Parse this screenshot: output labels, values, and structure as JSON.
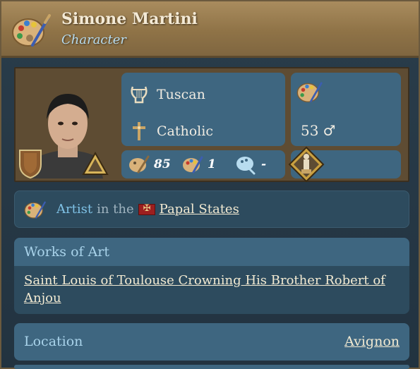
{
  "header": {
    "title": "Simone Martini",
    "subtitle": "Character",
    "icon": "palette-icon"
  },
  "portrait": {
    "culture": {
      "label": "Tuscan",
      "icon": "lyre-icon"
    },
    "religion": {
      "label": "Catholic",
      "icon": "crucifix-icon"
    },
    "age": {
      "value": "53",
      "gender_symbol": "♂"
    },
    "profession_icon": "palette-icon",
    "skills": [
      {
        "icon": "palette-brush-icon",
        "value": "85"
      },
      {
        "icon": "palette-icon",
        "value": "1"
      },
      {
        "icon": "paint-palette-blue-icon",
        "value": "-"
      }
    ],
    "trait_icon": "statue-icon"
  },
  "occupation": {
    "role": "Artist",
    "connector": "in the",
    "realm": "Papal States"
  },
  "works": {
    "heading": "Works of Art",
    "items": [
      "Saint Louis of Toulouse Crowning His Brother Robert of Anjou"
    ]
  },
  "location": {
    "label": "Location",
    "value": "Avignon"
  },
  "colors": {
    "header_gold": "#a98c5e",
    "panel_blue": "#3e6680",
    "dark_blue": "#2d4b5e",
    "subtitle_blue": "#b8dcef"
  }
}
